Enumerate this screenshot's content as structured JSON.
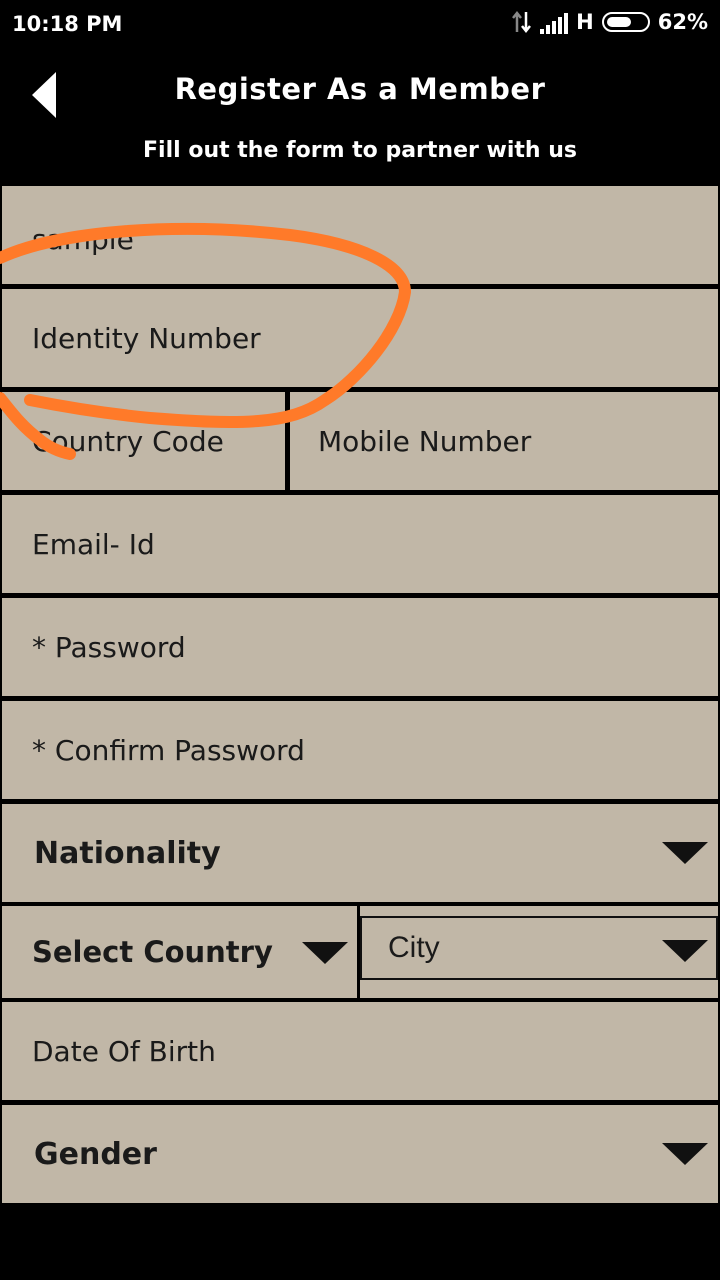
{
  "status_bar": {
    "time": "10:18 PM",
    "network": "H",
    "battery_percent": "62%",
    "battery_level": 0.62
  },
  "header": {
    "title": "Register As a Member",
    "subtitle": "Fill out the form to partner with us"
  },
  "form": {
    "name_value": "sample",
    "identity_placeholder": "Identity Number",
    "country_code_placeholder": "Country Code",
    "mobile_placeholder": "Mobile Number",
    "email_placeholder": "Email- Id",
    "password_placeholder": "* Password",
    "confirm_password_placeholder": "* Confirm Password",
    "nationality_label": "Nationality",
    "select_country_label": "Select Country",
    "city_label": "City",
    "dob_placeholder": "Date Of Birth",
    "gender_label": "Gender"
  },
  "colors": {
    "field_background": "#c1b7a7",
    "screen_background": "#000000",
    "annotation_stroke": "#ff7a29"
  }
}
